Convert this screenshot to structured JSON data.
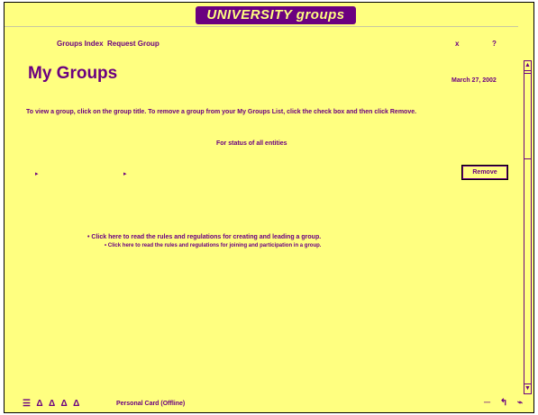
{
  "header": {
    "logo": "UNIVERSITY groups",
    "nav": [
      "Groups Index",
      "Request Group"
    ],
    "right_icons": [
      "x",
      "?"
    ]
  },
  "main": {
    "title": "My Groups",
    "date": "March 27, 2002",
    "instructions": "To view a group, click on the group title. To remove a group from your My Groups List, click the check box and then click Remove.",
    "filter": "For status of all entities",
    "bullets": [
      "▸",
      "▸"
    ],
    "remove_label": "Remove",
    "rules_line1": "• Click here to read the rules and regulations for creating and leading a group.",
    "rules_line2": "• Click here to read the rules and regulations for joining and participation in a group."
  },
  "scrollbar": {
    "up": "▲",
    "down": "▼"
  },
  "statusbar": {
    "icons": "☰ Δ Δ Δ Δ",
    "text": "Personal Card (Offline)",
    "right": "─ ↰ ⌁"
  }
}
